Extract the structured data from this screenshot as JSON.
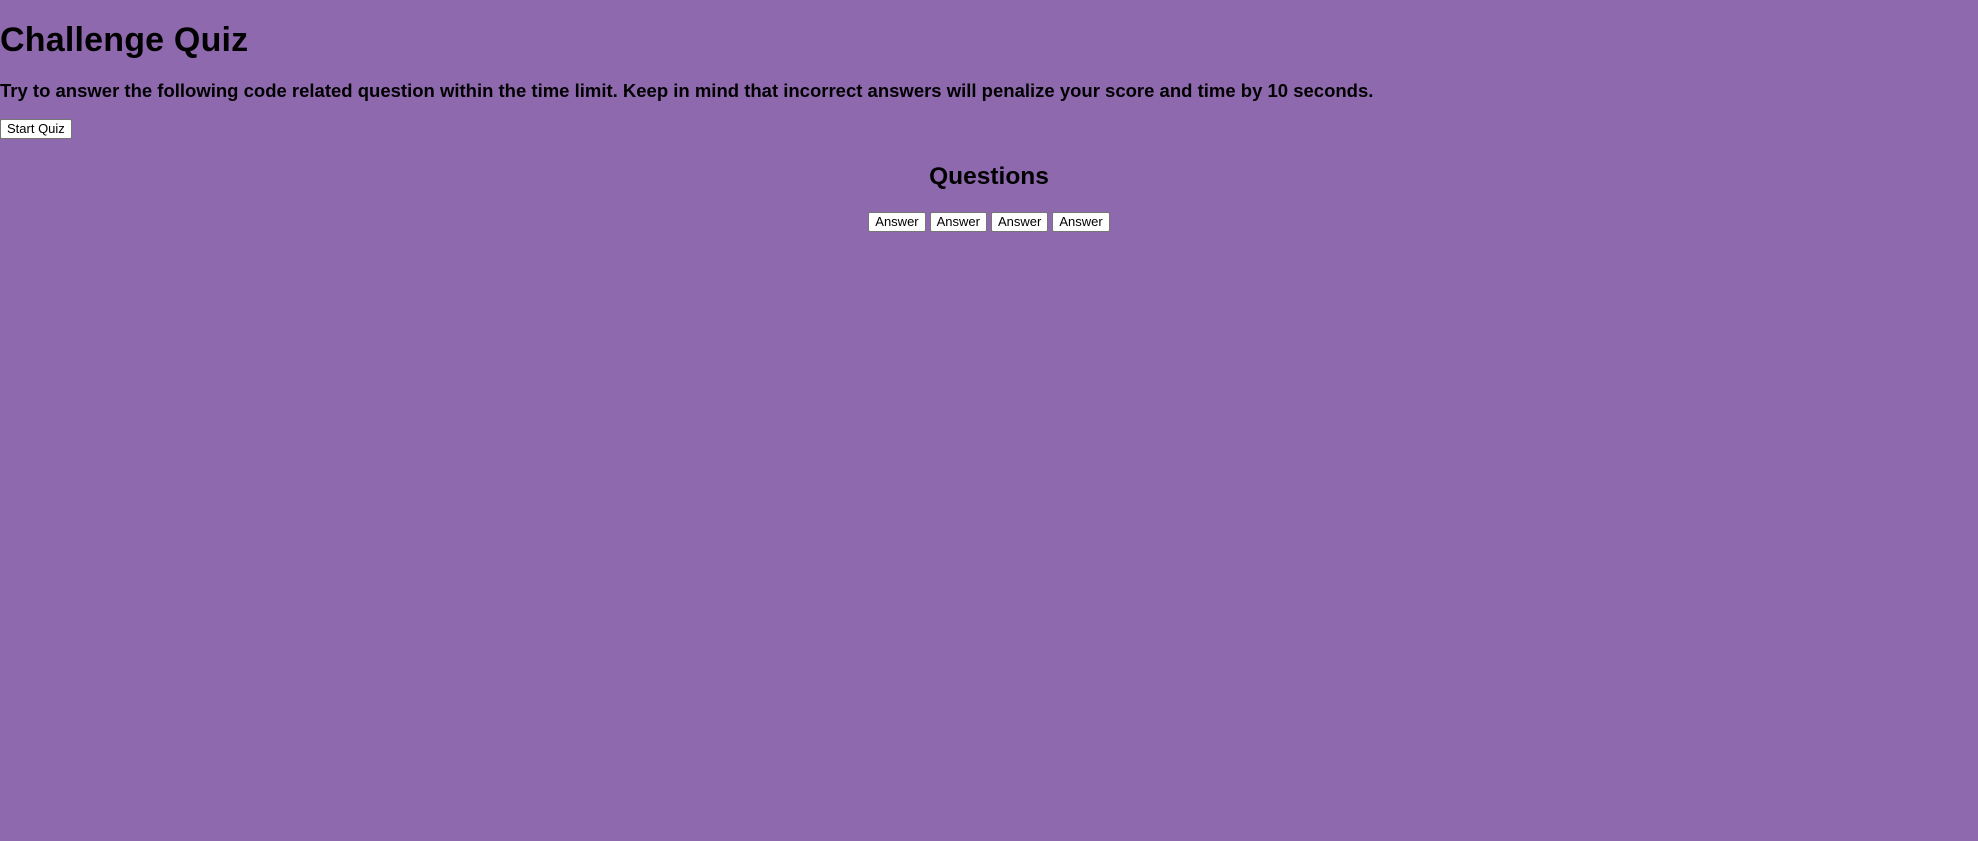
{
  "page": {
    "title": "Challenge Quiz",
    "instructions": "Try to answer the following code related question within the time limit. Keep in mind that incorrect answers will penalize your score and time by 10 seconds.",
    "start_button_label": "Start Quiz",
    "background_color": "#8f69ae"
  },
  "questions": {
    "heading": "Questions",
    "answers": [
      {
        "label": "Answer"
      },
      {
        "label": "Answer"
      },
      {
        "label": "Answer"
      },
      {
        "label": "Answer"
      }
    ]
  }
}
